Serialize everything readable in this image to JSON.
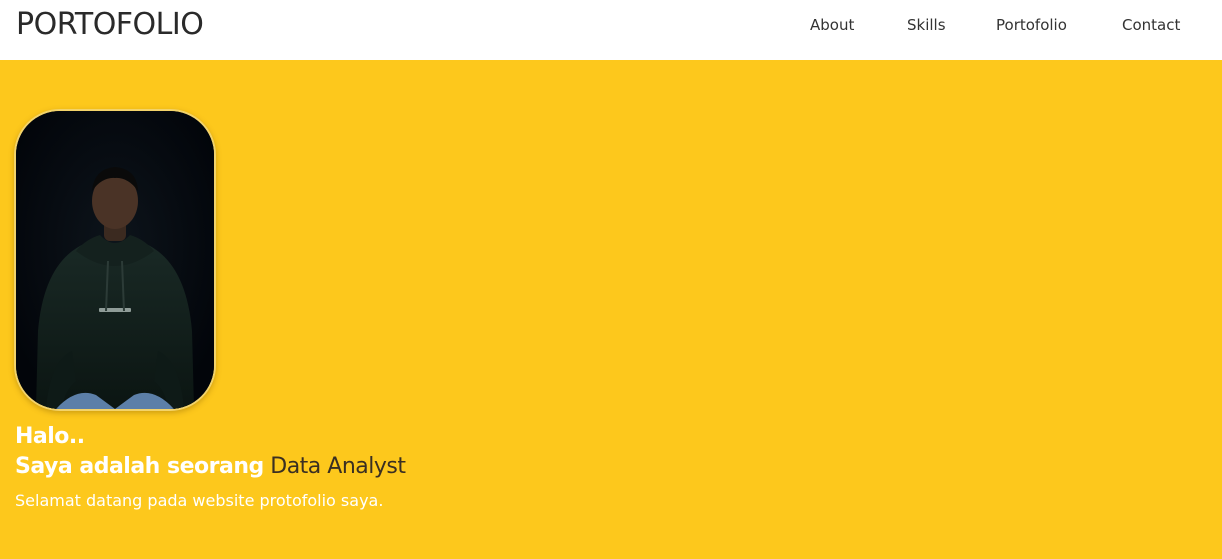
{
  "brand": {
    "title": "PORTOFOLIO"
  },
  "nav": {
    "items": [
      {
        "label": "About"
      },
      {
        "label": "Skills"
      },
      {
        "label": "Portofolio"
      },
      {
        "label": "Contact"
      }
    ]
  },
  "hero": {
    "greeting": "Halo..",
    "intro_prefix": "Saya adalah seorang",
    "role": "Data Analyst",
    "welcome": "Selamat datang pada website protofolio saya.",
    "background_color": "#fdc81c"
  },
  "colors": {
    "accent": "#fdc81c",
    "navbar_bg": "#ffffff",
    "text_dark": "#2a2a2a",
    "text_light": "#ffffff"
  }
}
